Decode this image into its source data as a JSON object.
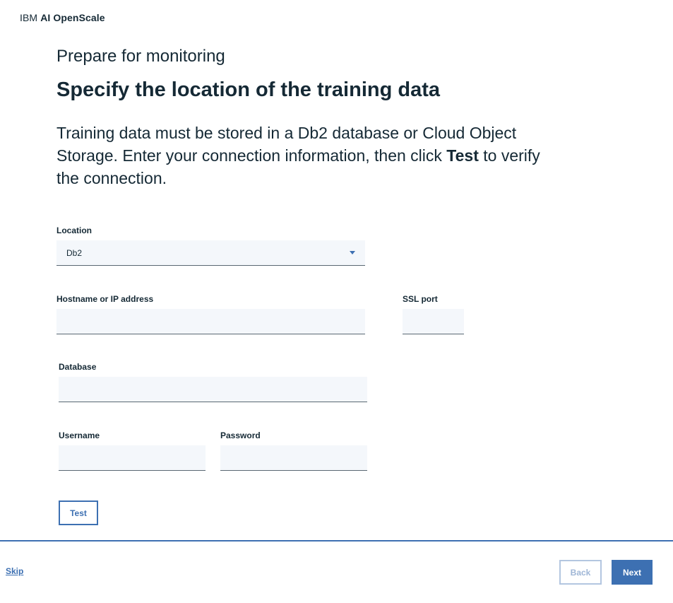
{
  "app": {
    "brand_prefix": "IBM",
    "brand_name": "AI OpenScale"
  },
  "header": {
    "step_label": "Prepare for monitoring",
    "title": "Specify the location of the training data",
    "intro_part1": "Training data must be stored in a Db2 database or Cloud Object Storage. Enter your connection information, then click ",
    "intro_bold": "Test",
    "intro_part2": " to verify the connection."
  },
  "form": {
    "location": {
      "label": "Location",
      "value": "Db2"
    },
    "hostname": {
      "label": "Hostname or IP address",
      "value": ""
    },
    "ssl_port": {
      "label": "SSL port",
      "value": ""
    },
    "database": {
      "label": "Database",
      "value": ""
    },
    "username": {
      "label": "Username",
      "value": ""
    },
    "password": {
      "label": "Password",
      "value": ""
    },
    "test_label": "Test"
  },
  "footer": {
    "skip_label": "Skip",
    "back_label": "Back",
    "next_label": "Next"
  },
  "colors": {
    "accent": "#3d70b2",
    "field_bg": "#f4f7fb",
    "text": "#152935"
  }
}
